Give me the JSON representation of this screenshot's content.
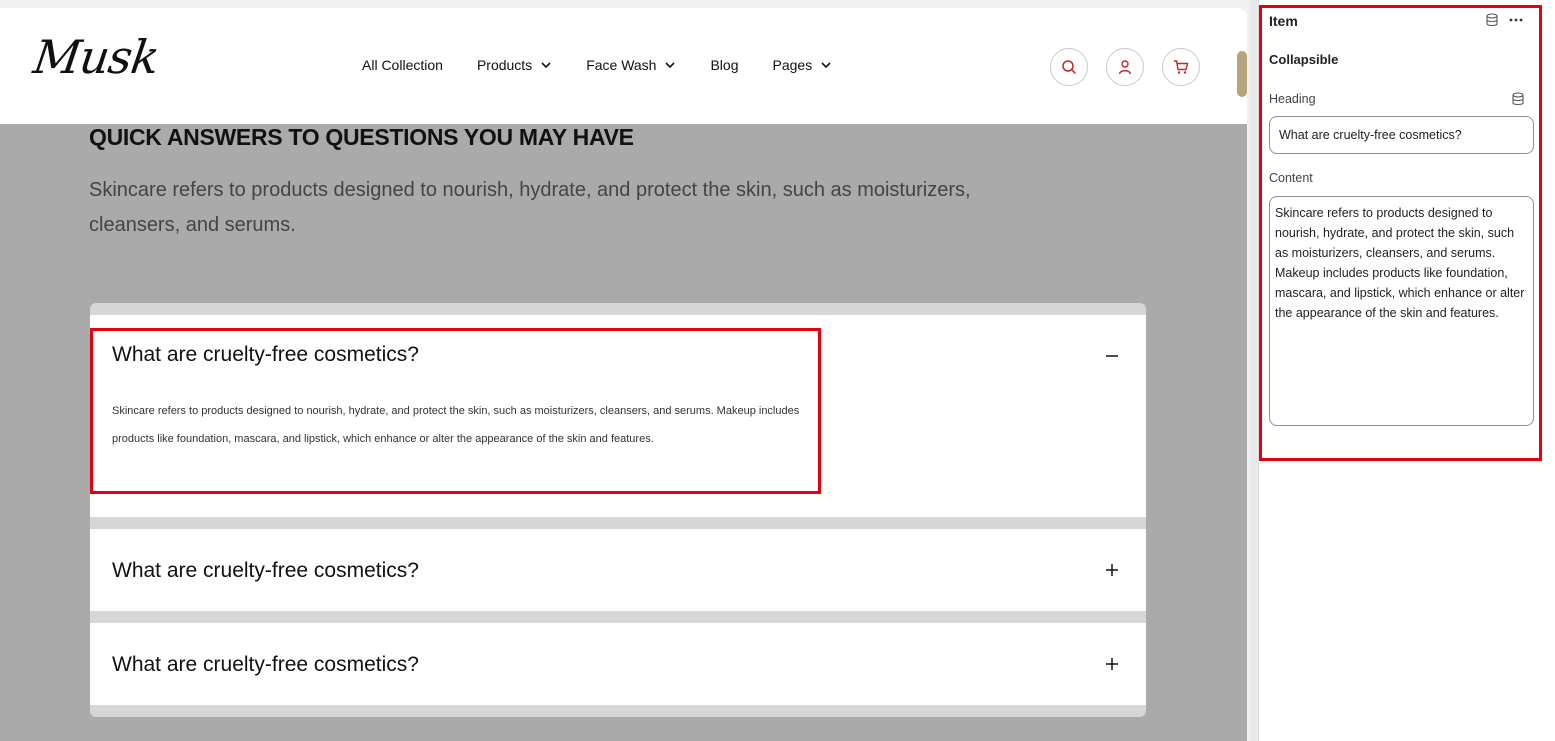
{
  "site": {
    "logo": "Musk",
    "nav": [
      {
        "label": "All Collection",
        "has_dropdown": false
      },
      {
        "label": "Products",
        "has_dropdown": true
      },
      {
        "label": "Face Wash",
        "has_dropdown": true
      },
      {
        "label": "Blog",
        "has_dropdown": false
      },
      {
        "label": "Pages",
        "has_dropdown": true
      }
    ],
    "header_icons": [
      "search-icon",
      "user-icon",
      "cart-icon"
    ],
    "accent_color": "#c0262d"
  },
  "faq": {
    "title": "QUICK ANSWERS TO QUESTIONS YOU MAY HAVE",
    "subtitle": "Skincare refers to products designed to nourish, hydrate, and protect the skin, such as moisturizers, cleansers, and serums.",
    "items": [
      {
        "question": "What are cruelty-free cosmetics?",
        "expanded": true,
        "answer": "Skincare refers to products designed to nourish, hydrate, and protect the skin, such as moisturizers, cleansers, and serums. Makeup includes products like foundation, mascara, and lipstick, which enhance or alter the appearance of the skin and features."
      },
      {
        "question": "What are cruelty-free cosmetics?",
        "expanded": false
      },
      {
        "question": "What are cruelty-free cosmetics?",
        "expanded": false
      }
    ]
  },
  "panel": {
    "title": "Item",
    "section": "Collapsible",
    "heading_label": "Heading",
    "heading_value": "What are cruelty-free cosmetics?",
    "content_label": "Content",
    "content_value": "Skincare refers to products designed to nourish, hydrate, and protect the skin, such as moisturizers, cleansers, and serums. Makeup includes products like foundation, mascara, and lipstick, which enhance or alter the appearance of the skin and features."
  },
  "colors": {
    "highlight": "#e3000f",
    "overlay": "#aaaaaa",
    "scrollbar": "#b8a47c"
  }
}
